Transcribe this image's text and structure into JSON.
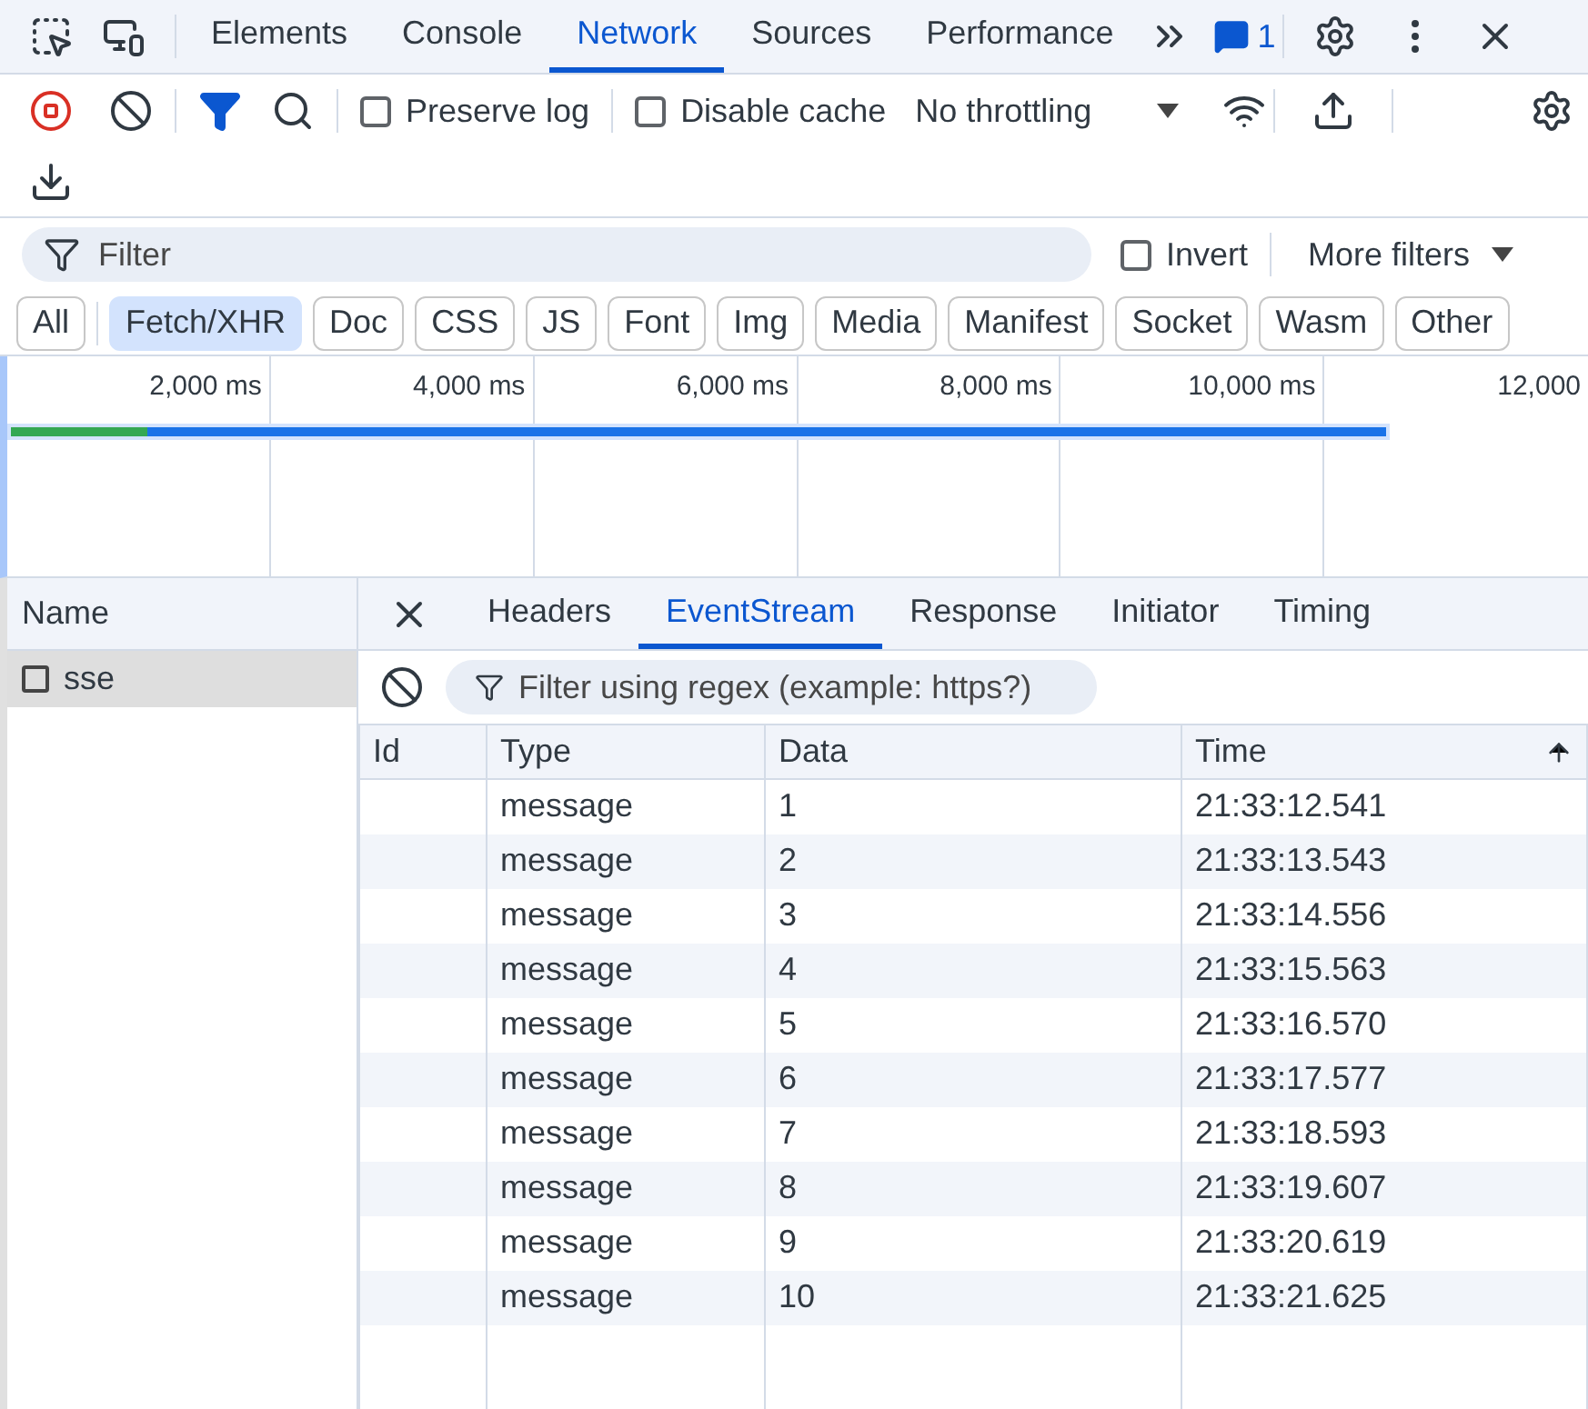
{
  "tabs": [
    {
      "label": "Elements",
      "selected": false
    },
    {
      "label": "Console",
      "selected": false
    },
    {
      "label": "Network",
      "selected": true
    },
    {
      "label": "Sources",
      "selected": false
    },
    {
      "label": "Performance",
      "selected": false
    }
  ],
  "issues_count": "1",
  "toolbar": {
    "recording": true,
    "preserve_log": {
      "label": "Preserve log",
      "checked": false
    },
    "disable_cache": {
      "label": "Disable cache",
      "checked": false
    },
    "throttling": "No throttling"
  },
  "filter": {
    "placeholder": "Filter",
    "invert": {
      "label": "Invert",
      "checked": false
    },
    "more_filters": "More filters"
  },
  "type_filters": [
    {
      "label": "All",
      "selected": false
    },
    {
      "label": "Fetch/XHR",
      "selected": true
    },
    {
      "label": "Doc",
      "selected": false
    },
    {
      "label": "CSS",
      "selected": false
    },
    {
      "label": "JS",
      "selected": false
    },
    {
      "label": "Font",
      "selected": false
    },
    {
      "label": "Img",
      "selected": false
    },
    {
      "label": "Media",
      "selected": false
    },
    {
      "label": "Manifest",
      "selected": false
    },
    {
      "label": "Socket",
      "selected": false
    },
    {
      "label": "Wasm",
      "selected": false
    },
    {
      "label": "Other",
      "selected": false
    }
  ],
  "timeline": {
    "ticks": [
      "2,000 ms",
      "4,000 ms",
      "6,000 ms",
      "8,000 ms",
      "10,000 ms",
      "12,000"
    ]
  },
  "requests": {
    "column": "Name",
    "items": [
      {
        "name": "sse",
        "selected": true
      }
    ]
  },
  "detail_tabs": [
    {
      "label": "Headers",
      "selected": false
    },
    {
      "label": "EventStream",
      "selected": true
    },
    {
      "label": "Response",
      "selected": false
    },
    {
      "label": "Initiator",
      "selected": false
    },
    {
      "label": "Timing",
      "selected": false
    }
  ],
  "event_filter": {
    "placeholder": "Filter using regex (example: https?)"
  },
  "events": {
    "columns": [
      "Id",
      "Type",
      "Data",
      "Time"
    ],
    "rows": [
      {
        "type": "message",
        "data": "1",
        "time": "21:33:12.541"
      },
      {
        "type": "message",
        "data": "2",
        "time": "21:33:13.543"
      },
      {
        "type": "message",
        "data": "3",
        "time": "21:33:14.556"
      },
      {
        "type": "message",
        "data": "4",
        "time": "21:33:15.563"
      },
      {
        "type": "message",
        "data": "5",
        "time": "21:33:16.570"
      },
      {
        "type": "message",
        "data": "6",
        "time": "21:33:17.577"
      },
      {
        "type": "message",
        "data": "7",
        "time": "21:33:18.593"
      },
      {
        "type": "message",
        "data": "8",
        "time": "21:33:19.607"
      },
      {
        "type": "message",
        "data": "9",
        "time": "21:33:20.619"
      },
      {
        "type": "message",
        "data": "10",
        "time": "21:33:21.625"
      }
    ]
  }
}
